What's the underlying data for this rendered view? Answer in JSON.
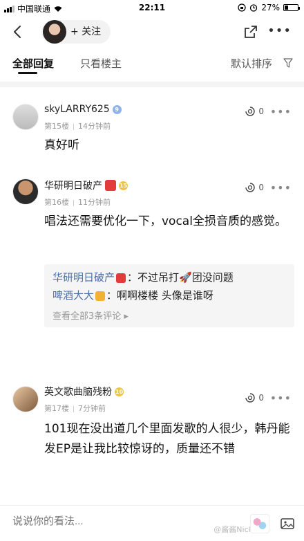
{
  "status_bar": {
    "carrier": "中国联通",
    "time": "22:11",
    "battery": "27%",
    "battery_level": 0.27
  },
  "nav": {
    "follow_label": "+ 关注"
  },
  "tabs": {
    "all_replies": "全部回复",
    "op_only": "只看楼主",
    "sort": "默认排序"
  },
  "comments": [
    {
      "name": "skyLARRY625",
      "badge": "9",
      "floor": "第15楼",
      "time": "14分钟前",
      "likes": "0",
      "body": "真好听"
    },
    {
      "name": "华研明日破产",
      "badge": "15",
      "floor": "第16楼",
      "time": "11分钟前",
      "likes": "0",
      "body": "唱法还需要优化一下，vocal全损音质的感觉。",
      "replies": [
        {
          "name": "华研明日破产",
          "text": "：不过吊打🚀团没问题"
        },
        {
          "name": "啤酒大大",
          "text": "：啊啊楼楼 头像是谁呀"
        }
      ],
      "view_all": "查看全部3条评论"
    },
    {
      "name": "英文歌曲脑残粉",
      "badge": "10",
      "floor": "第17楼",
      "time": "7分钟前",
      "likes": "0",
      "body": "101现在没出道几个里面发歌的人很少，韩丹能发EP是让我比较惊讶的，质量还不错"
    }
  ],
  "bottom": {
    "placeholder": "说说你的看法...",
    "watermark": "@酱酱Nick"
  },
  "colors": {
    "reply_name": "#4a6fa5",
    "badge_blue": "#8fb3e8",
    "badge_gold": "#f0c24a"
  }
}
